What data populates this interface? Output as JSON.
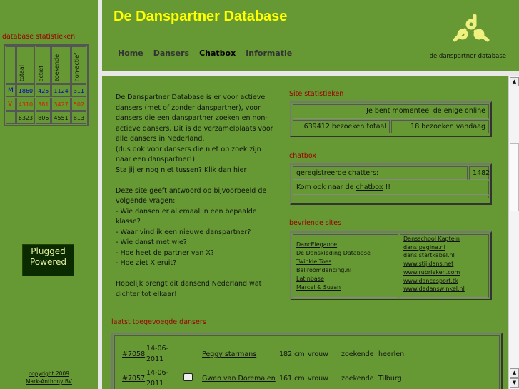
{
  "sidebar": {
    "stats_title": "database statistieken",
    "headers": [
      "totaal",
      "actief",
      "zoekende",
      "non-actief"
    ],
    "rows": [
      {
        "label": "M",
        "values": [
          "1860",
          "425",
          "1124",
          "311"
        ]
      },
      {
        "label": "V",
        "values": [
          "4310",
          "381",
          "3427",
          "502"
        ]
      },
      {
        "label": "",
        "values": [
          "6323",
          "806",
          "4551",
          "813"
        ]
      }
    ],
    "badge_line1": "Plugged",
    "badge_line2": "Powered",
    "copyright_line1": "copyright 2009",
    "copyright_line2": "Mark-Anthony BV"
  },
  "header": {
    "title": "De Danspartner Database",
    "logo_caption": "de danspartner database",
    "nav": [
      "Home",
      "Dansers",
      "Chatbox",
      "Informatie"
    ]
  },
  "intro": {
    "p1": "De Danspartner Database is er voor actieve dansers (met of zonder danspartner), voor dansers die een danspartner zoeken en non-actieve dansers. Dit is de verzamelplaats voor alle dansers in Nederland.",
    "p2": "(dus ook voor dansers die niet op zoek zijn naar een danspartner!)",
    "p3": "Sta jij er nog niet tussen? ",
    "p3_link": "Klik dan hier",
    "p4": "Deze site geeft antwoord op bijvoorbeeld de volgende vragen:",
    "questions": [
      "- Wie dansen er allemaal in een bepaalde klasse?",
      "- Waar vind ik een nieuwe danspartner?",
      "- Wie danst met wie?",
      "- Hoe heet de partner van X?",
      "- Hoe ziet X eruit?"
    ],
    "p5": "Hopelijk brengt dit dansend Nederland wat dichter tot elkaar!"
  },
  "site_stats": {
    "title": "Site statistieken",
    "online": "Je bent momenteel de enige online",
    "total": "639412 bezoeken totaal",
    "today": "18 bezoeken vandaag"
  },
  "chatbox": {
    "title": "chatbox",
    "registered_label": "geregistreerde chatters:",
    "registered_count": "1482",
    "invite": "Kom ook naar de ",
    "invite_link": "chatbox",
    "invite_end": " !!"
  },
  "friends": {
    "title": "bevriende sites",
    "left": [
      "DancElegance",
      "De Danskleding Database",
      "Twinkle Toes",
      "Ballroomdancing.nl",
      "Latinbase",
      "Marcel & Suzan"
    ],
    "right": [
      "Dansschool Kaptein",
      "dans.pagina.nl",
      "dans.startkabel.nl",
      "www.stijldans.net",
      "www.rubrieken.com",
      "www.dancesport.tk",
      "www.dedanswinkel.nl"
    ]
  },
  "latest": {
    "title": "laatst toegevoegde dansers",
    "rows": [
      {
        "id": "#7058",
        "date1": "14-06-",
        "date2": "2011",
        "photo": false,
        "name": "Peggy starmans",
        "height": "182 cm",
        "gender": "vrouw",
        "status": "zoekende",
        "city": "heerlen"
      },
      {
        "id": "#7057",
        "date1": "14-06-",
        "date2": "2011",
        "photo": true,
        "name": "Gwen van Doremalen",
        "height": "161 cm",
        "gender": "vrouw",
        "status": "zoekende",
        "city": "Tilburg"
      }
    ]
  }
}
